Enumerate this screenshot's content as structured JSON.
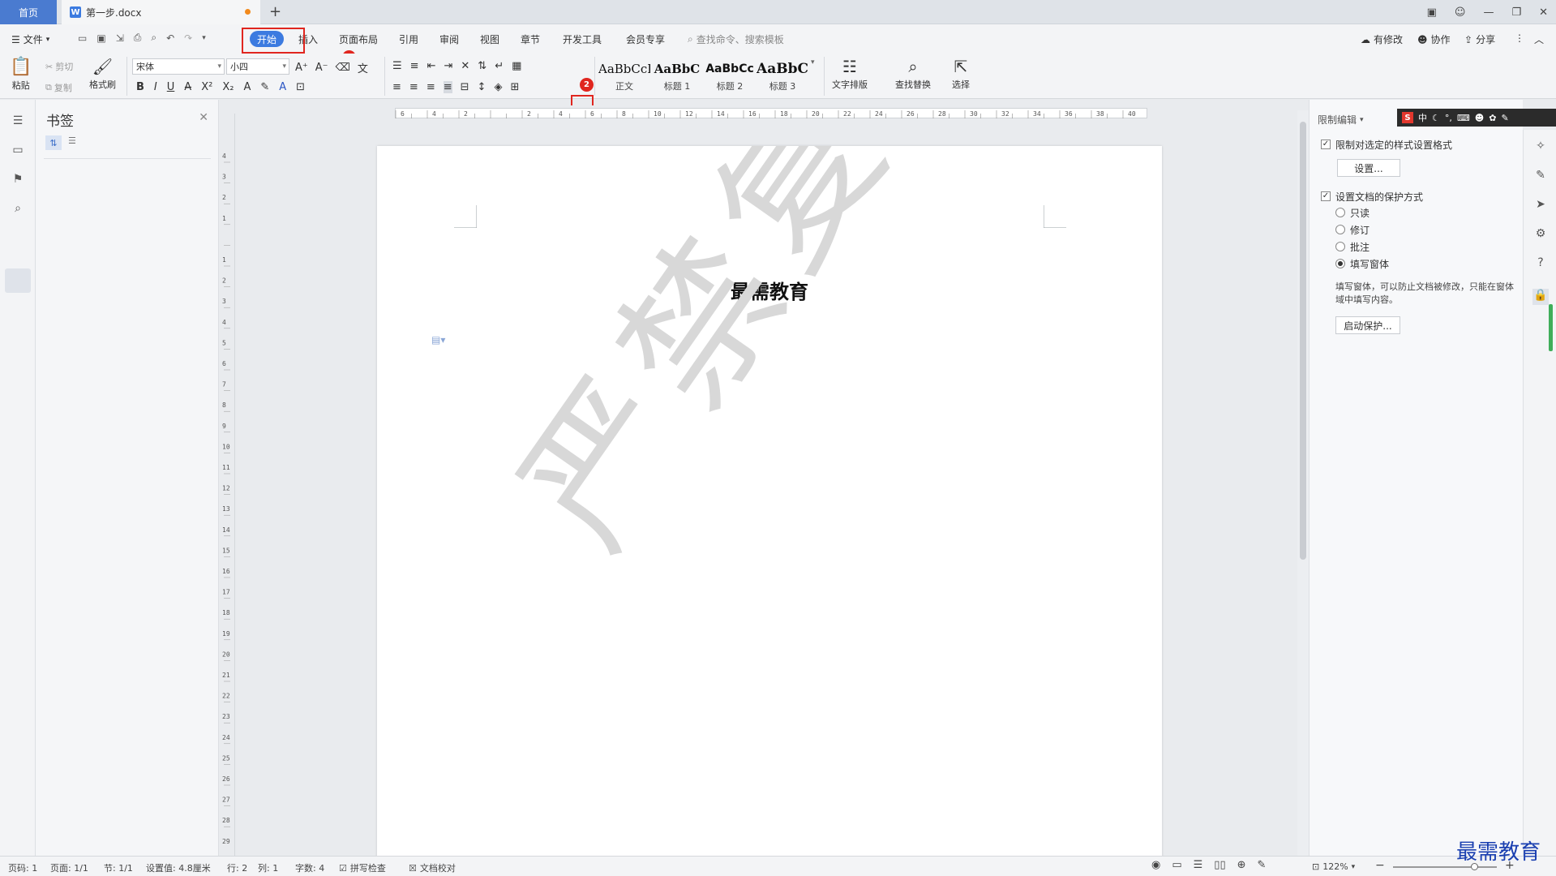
{
  "tabs": {
    "home": "首页",
    "document": "第一步.docx",
    "add": "+"
  },
  "menu": {
    "file": "文件",
    "items": [
      "开始",
      "插入",
      "页面布局",
      "引用",
      "审阅",
      "视图",
      "章节",
      "开发工具",
      "会员专享"
    ],
    "search_placeholder": "查找命令、搜索模板",
    "right": {
      "modify": "有修改",
      "collab": "协作",
      "share": "分享"
    }
  },
  "ribbon": {
    "paste": "粘贴",
    "cut": "剪切",
    "copy": "复制",
    "format_painter": "格式刷",
    "font_name": "宋体",
    "font_size": "小四",
    "styles": [
      {
        "sample": "AaBbCcI",
        "label": "正文"
      },
      {
        "sample": "AaBbC",
        "label": "标题 1"
      },
      {
        "sample": "AaBbCc",
        "label": "标题 2"
      },
      {
        "sample": "AaBbC",
        "label": "标题 3"
      }
    ],
    "text_layout": "文字排版",
    "find_replace": "查找替换",
    "select": "选择"
  },
  "badges": {
    "one": "1",
    "two": "2"
  },
  "bookmark": {
    "title": "书签"
  },
  "document": {
    "title": "最需教育",
    "watermark": "严禁复制"
  },
  "right_panel": {
    "title": "限制编辑",
    "restrict_style": "限制对选定的样式设置格式",
    "settings_btn": "设置...",
    "protect_method": "设置文档的保护方式",
    "options": [
      "只读",
      "修订",
      "批注",
      "填写窗体"
    ],
    "selected_option": "填写窗体",
    "description": "填写窗体，可以防止文档被修改，只能在窗体域中填写内容。",
    "start_btn": "启动保护..."
  },
  "ime": {
    "lang": "中"
  },
  "status": {
    "page_code": "页码: 1",
    "page": "页面: 1/1",
    "section": "节: 1/1",
    "setting": "设置值: 4.8厘米",
    "row": "行: 2",
    "col": "列: 1",
    "words": "字数: 4",
    "spell": "拼写检查",
    "doc_check": "文档校对",
    "zoom": "122%",
    "zoom_level": 0.78
  },
  "brand": "最需教育",
  "colors": {
    "accent": "#3c7be0",
    "highlight": "#e0261f",
    "home_tab": "#4a7bd0"
  }
}
